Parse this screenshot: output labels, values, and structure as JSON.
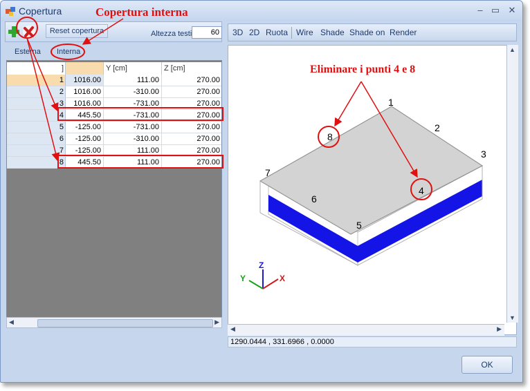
{
  "window": {
    "title": "Copertura",
    "controls": [
      "–",
      "▭",
      "✕"
    ]
  },
  "toolbar": {
    "add_icon": "green-plus-icon",
    "delete_icon": "red-x-icon",
    "reset_label": "Reset copertura",
    "altezza_label": "Altezza testi",
    "altezza_value": "60"
  },
  "view_toolbar": {
    "buttons": [
      "3D",
      "2D",
      "Ruota",
      "Wire",
      "Shade",
      "Shade on",
      "Render"
    ]
  },
  "tabs": [
    "Esterna",
    "Interna"
  ],
  "grid": {
    "columns": [
      "]",
      "Y [cm]",
      "Z [cm]"
    ],
    "rows": [
      {
        "n": "1",
        "x": "1016.00",
        "y": "111.00",
        "z": "270.00"
      },
      {
        "n": "2",
        "x": "1016.00",
        "y": "-310.00",
        "z": "270.00"
      },
      {
        "n": "3",
        "x": "1016.00",
        "y": "-731.00",
        "z": "270.00"
      },
      {
        "n": "4",
        "x": "445.50",
        "y": "-731.00",
        "z": "270.00"
      },
      {
        "n": "5",
        "x": "-125.00",
        "y": "-731.00",
        "z": "270.00"
      },
      {
        "n": "6",
        "x": "-125.00",
        "y": "-310.00",
        "z": "270.00"
      },
      {
        "n": "7",
        "x": "-125.00",
        "y": "111.00",
        "z": "270.00"
      },
      {
        "n": "8",
        "x": "445.50",
        "y": "111.00",
        "z": "270.00"
      }
    ]
  },
  "viewport": {
    "point_labels": [
      "1",
      "2",
      "3",
      "4",
      "5",
      "6",
      "7",
      "8"
    ],
    "axes": {
      "z": "Z",
      "y": "Y",
      "x": "X"
    }
  },
  "status_text": "1290.0444 , 331.6966 , 0.0000",
  "ok_label": "OK",
  "annotations": {
    "title_note": "Copertura interna",
    "viewport_note": "Eliminare i punti 4 e 8"
  },
  "colors": {
    "accent_red": "#e01010",
    "roof_gray": "#d3d3d3",
    "roof_blue": "#1414e6",
    "selected_row": "#f8dcae"
  }
}
